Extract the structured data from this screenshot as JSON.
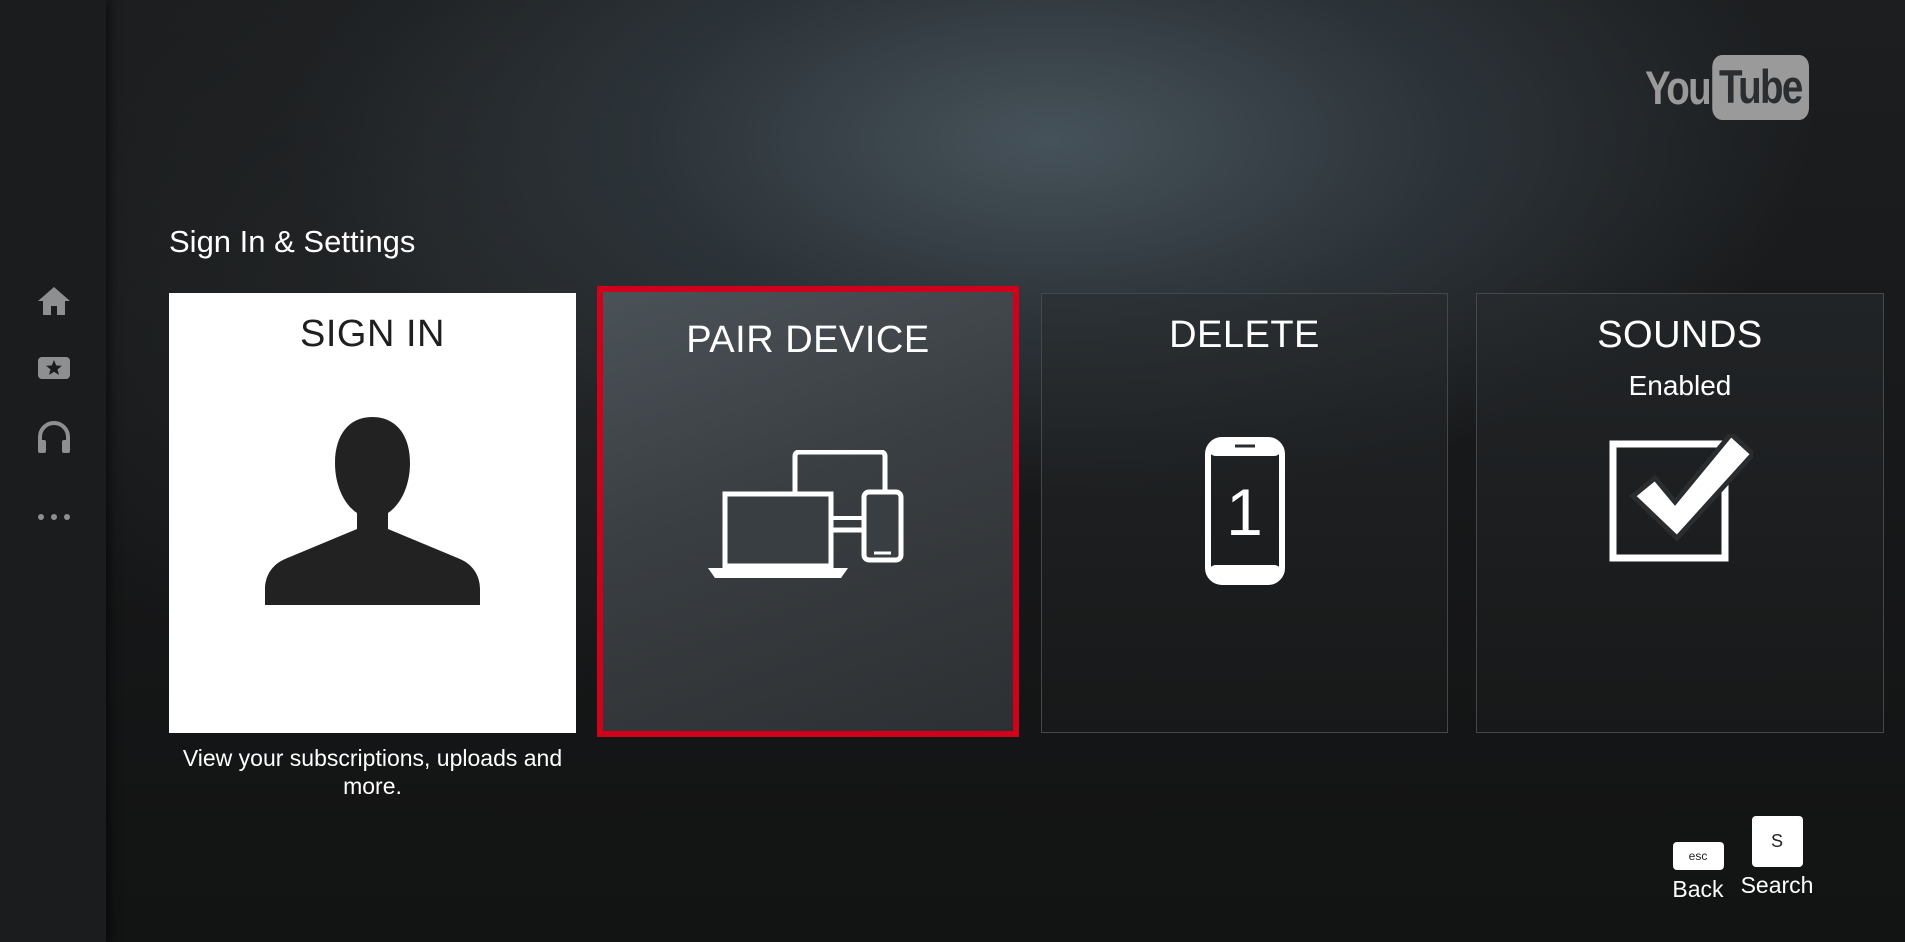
{
  "logo": {
    "you": "You",
    "tube": "Tube"
  },
  "sidebar": {
    "items": [
      {
        "icon": "home-icon"
      },
      {
        "icon": "star-icon"
      },
      {
        "icon": "headphones-icon"
      },
      {
        "icon": "more-icon"
      }
    ]
  },
  "section_title": "Sign In & Settings",
  "tiles": {
    "sign_in": {
      "title": "SIGN IN",
      "caption": "View your subscriptions, uploads and more.",
      "icon": "person-silhouette-icon"
    },
    "pair_device": {
      "title": "PAIR DEVICE",
      "icon": "devices-icon",
      "selected": true,
      "highlight_color": "#d0021b"
    },
    "delete": {
      "title": "DELETE",
      "icon": "phone-number-icon",
      "phone_digit": "1"
    },
    "sounds": {
      "title": "SOUNDS",
      "status": "Enabled",
      "icon": "checkbox-checked-icon"
    }
  },
  "hints": {
    "back": {
      "key": "esc",
      "label": "Back"
    },
    "search": {
      "key": "S",
      "label": "Search"
    }
  }
}
